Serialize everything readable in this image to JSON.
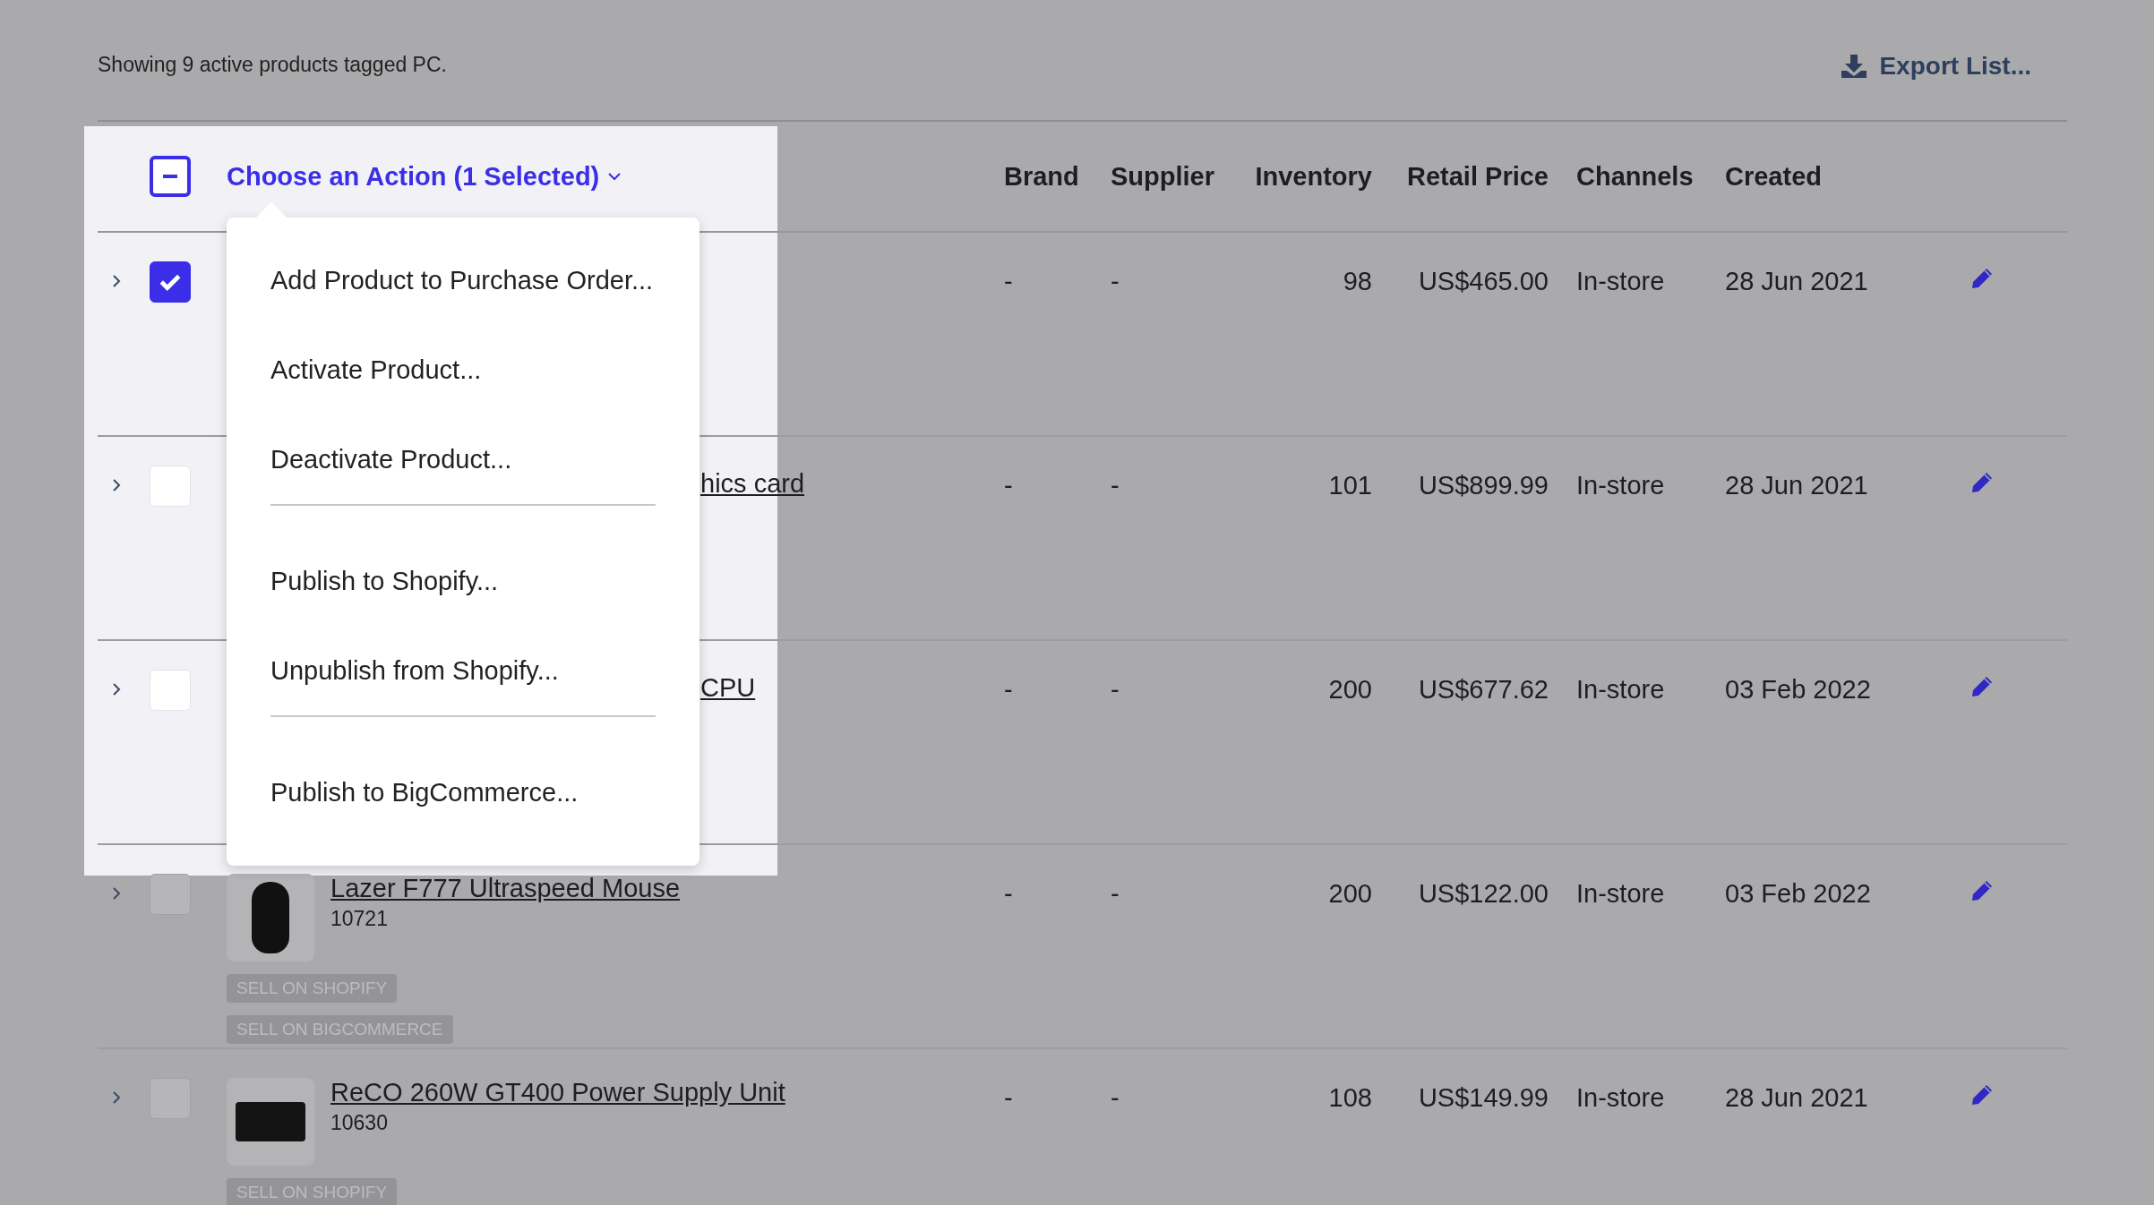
{
  "summary": "Showing 9 active products tagged PC.",
  "export_button": "Export List...",
  "bulk_action": {
    "indeterminate": true,
    "label": "Choose an Action (1 Selected)",
    "expanded": true
  },
  "action_menu": [
    [
      "Add Product to Purchase Order...",
      "Activate Product...",
      "Deactivate Product..."
    ],
    [
      "Publish to Shopify...",
      "Unpublish from Shopify..."
    ],
    [
      "Publish to BigCommerce..."
    ]
  ],
  "columns": [
    "Brand",
    "Supplier",
    "Inventory",
    "Retail Price",
    "Channels",
    "Created"
  ],
  "rows": [
    {
      "selected": true,
      "dimmed": false,
      "covered": true,
      "brand": "-",
      "supplier": "-",
      "inventory": "98",
      "price": "US$465.00",
      "channels": "In-store",
      "created": "28 Jun 2021"
    },
    {
      "selected": false,
      "dimmed": false,
      "covered": true,
      "name": "hics card",
      "brand": "-",
      "supplier": "-",
      "inventory": "101",
      "price": "US$899.99",
      "channels": "In-store",
      "created": "28 Jun 2021"
    },
    {
      "selected": false,
      "dimmed": false,
      "covered": true,
      "name": "CPU",
      "brand": "-",
      "supplier": "-",
      "inventory": "200",
      "price": "US$677.62",
      "channels": "In-store",
      "created": "03 Feb 2022"
    },
    {
      "selected": false,
      "dimmed": true,
      "covered": false,
      "name": "Lazer F777 Ultraspeed Mouse",
      "sku": "10721",
      "tags": [
        "SELL ON SHOPIFY",
        "SELL ON BIGCOMMERCE"
      ],
      "brand": "-",
      "supplier": "-",
      "inventory": "200",
      "price": "US$122.00",
      "channels": "In-store",
      "created": "03 Feb 2022"
    },
    {
      "selected": false,
      "dimmed": true,
      "covered": false,
      "name": "ReCO 260W GT400 Power Supply Unit",
      "sku": "10630",
      "tags": [
        "SELL ON SHOPIFY"
      ],
      "brand": "-",
      "supplier": "-",
      "inventory": "108",
      "price": "US$149.99",
      "channels": "In-store",
      "created": "28 Jun 2021"
    }
  ]
}
